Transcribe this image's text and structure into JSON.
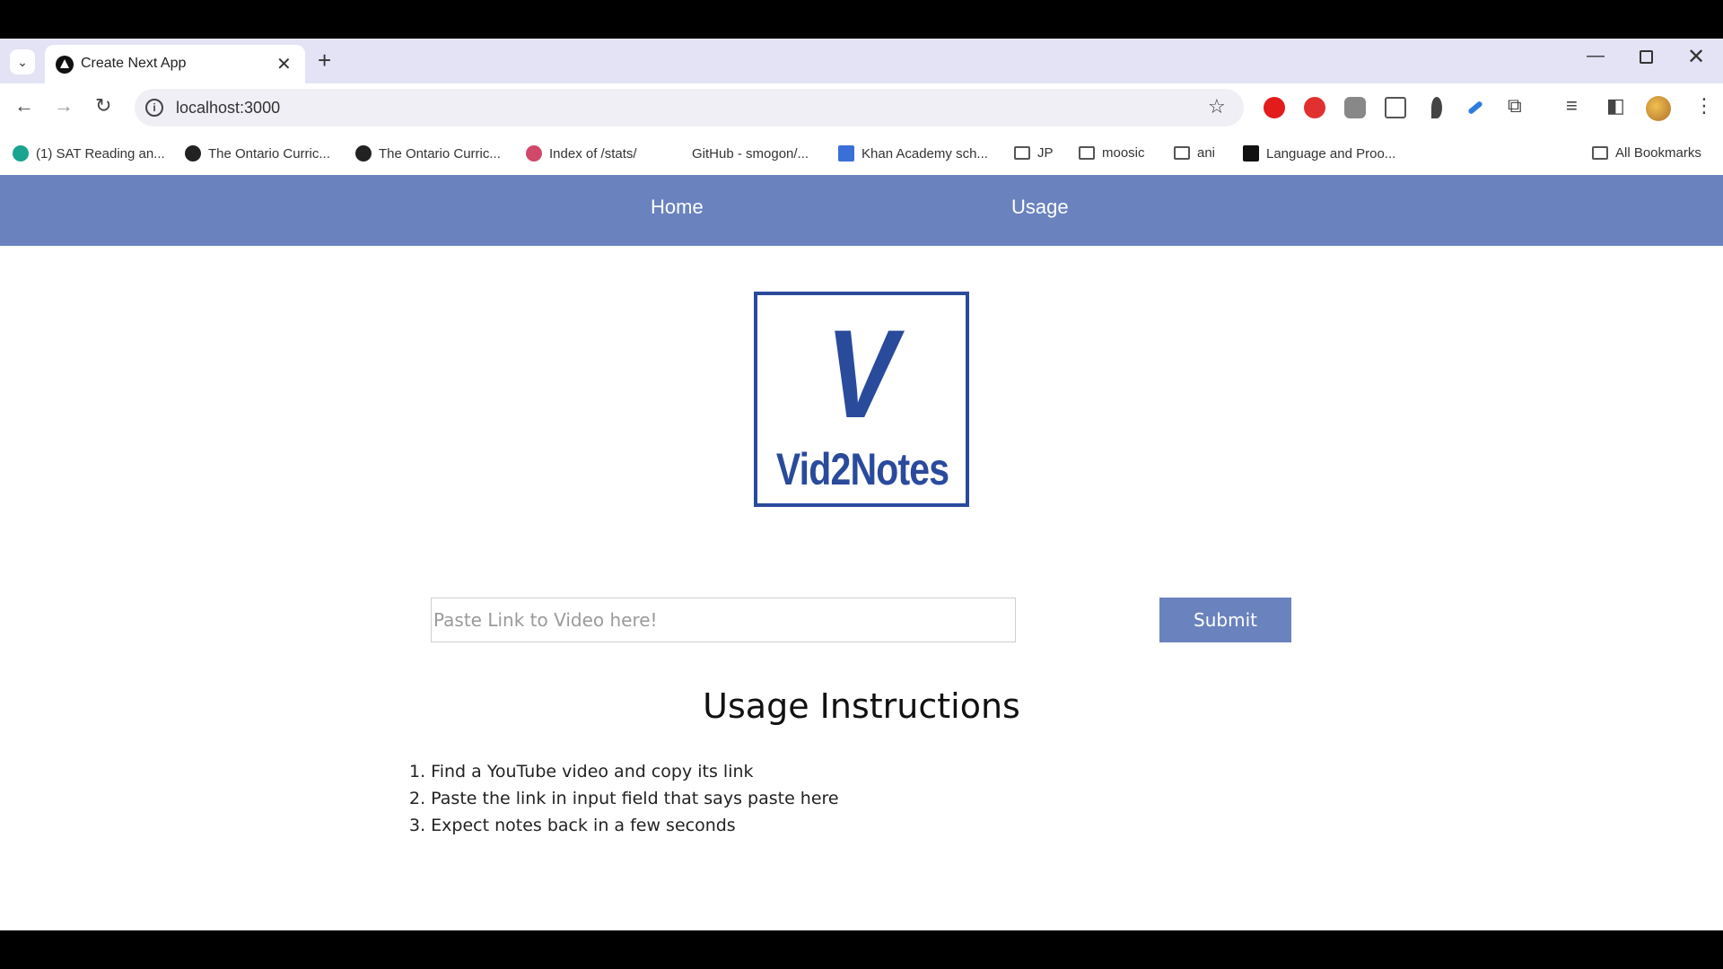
{
  "browser": {
    "tab_title": "Create Next App",
    "url": "localhost:3000",
    "bookmarks": [
      {
        "label": "(1) SAT Reading an...",
        "icon": "teal-hex-icon"
      },
      {
        "label": "The Ontario Curric...",
        "icon": "shield-icon"
      },
      {
        "label": "The Ontario Curric...",
        "icon": "shield-icon"
      },
      {
        "label": "Index of /stats/",
        "icon": "stats-icon"
      },
      {
        "label": "GitHub - smogon/...",
        "icon": "github-icon"
      },
      {
        "label": "Khan Academy sch...",
        "icon": "doc-icon"
      },
      {
        "label": "JP",
        "icon": "folder-icon"
      },
      {
        "label": "moosic",
        "icon": "folder-icon"
      },
      {
        "label": "ani",
        "icon": "folder-icon"
      },
      {
        "label": "Language and Proo...",
        "icon": "dzl-icon"
      }
    ],
    "all_bookmarks": "All Bookmarks"
  },
  "nav": {
    "home": "Home",
    "usage": "Usage"
  },
  "logo": {
    "letter": "V",
    "name": "Vid2Notes"
  },
  "form": {
    "placeholder": "Paste Link to Video here!",
    "submit": "Submit"
  },
  "usage": {
    "title": "Usage Instructions",
    "steps": [
      "1. Find a YouTube video and copy its link",
      "2. Paste the link in input field that says paste here",
      "3. Expect notes back in a few seconds"
    ]
  },
  "colors": {
    "navbar": "#6a82be",
    "logo": "#2a4a9c"
  }
}
